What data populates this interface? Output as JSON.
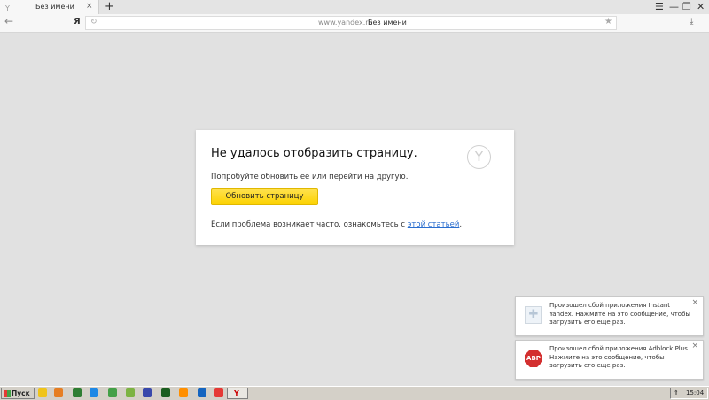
{
  "tab": {
    "title": "Без имени",
    "favicon": "Y",
    "close": "×",
    "new_tab": "+"
  },
  "window_controls": {
    "menu": "☰",
    "minimize": "—",
    "restore": "❐",
    "close": "✕"
  },
  "nav": {
    "back": "←",
    "yandex_button": "Я",
    "reload": "↻",
    "url": "www.yandex.ru",
    "page_title": "Без имени",
    "bookmark": "★",
    "downloads": "⤓"
  },
  "error": {
    "title": "Не удалось отобразить страницу.",
    "hint": "Попробуйте обновить ее или перейти на другую.",
    "button": "Обновить страницу",
    "footer_prefix": "Если проблема возникает часто, ознакомьтесь с ",
    "footer_link": "этой статьей",
    "footer_suffix": ".",
    "logo": "Y"
  },
  "notifications": [
    {
      "icon": "puzzle-icon",
      "glyph": "✚",
      "text": "Произошел сбой приложения Instant Yandex. Нажмите на это сообщение, чтобы загрузить его еще раз.",
      "close": "×"
    },
    {
      "icon": "adblock-icon",
      "glyph": "ABP",
      "text": "Произошел сбой приложения Adblock Plus. Нажмите на это сообщение, чтобы загрузить его еще раз.",
      "close": "×"
    }
  ],
  "taskbar": {
    "start_label": "Пуск",
    "active_app": "Y",
    "tray_arrow": "⇑",
    "clock": "15:04",
    "icon_colors": [
      "#f0c419",
      "#e67e22",
      "#2e7d32",
      "#1e88e5",
      "#43a047",
      "#7cb342",
      "#3949ab",
      "#1b5e20",
      "#ff8f00",
      "#1565c0",
      "#e53935",
      "#d32f2f"
    ]
  }
}
